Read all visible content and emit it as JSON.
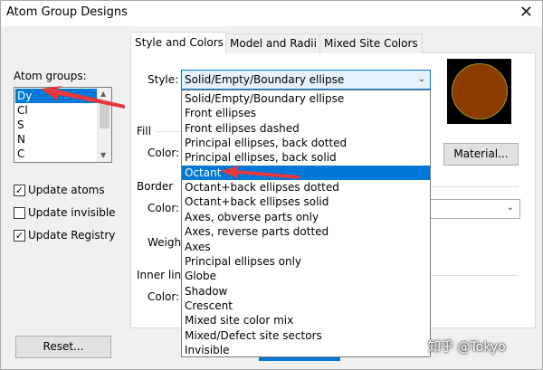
{
  "window": {
    "title": "Atom Group Designs",
    "close_glyph": "✕"
  },
  "left": {
    "atom_groups_label": "Atom groups:",
    "atom_groups": [
      "Dy",
      "Cl",
      "S",
      "N",
      "C"
    ],
    "selected_index": 0,
    "checkboxes": [
      {
        "label": "Update atoms",
        "checked": true
      },
      {
        "label": "Update invisible",
        "checked": false
      },
      {
        "label": "Update Registry",
        "checked": true
      }
    ],
    "reset_label": "Reset..."
  },
  "tabs": [
    "Style and Colors",
    "Model and Radii",
    "Mixed Site Colors"
  ],
  "active_tab": 0,
  "style": {
    "label": "Style:",
    "value": "Solid/Empty/Boundary ellipse",
    "options": [
      "Solid/Empty/Boundary ellipse",
      "Front ellipses",
      "Front ellipses dashed",
      "Principal ellipses, back dotted",
      "Principal ellipses, back solid",
      "Octant",
      "Octant+back ellipses dotted",
      "Octant+back ellipses solid",
      "Axes, obverse parts only",
      "Axes, reverse parts dotted",
      "Axes",
      "Principal ellipses only",
      "Globe",
      "Shadow",
      "Crescent",
      "Mixed site color mix",
      "Mixed/Defect site sectors",
      "Invisible"
    ],
    "highlighted_index": 5
  },
  "sections": {
    "fill": "Fill",
    "fill_color": "Color:",
    "border": "Border",
    "border_color": "Color:",
    "border_weight": "Weigh",
    "inner_lines": "Inner line",
    "inner_color": "Color:"
  },
  "material_label": "Material...",
  "preview_colors": {
    "ball": "#8b3b00",
    "background": "#000000"
  },
  "watermark": "知乎 @Tokyo",
  "arrow_color": "#e8383d"
}
